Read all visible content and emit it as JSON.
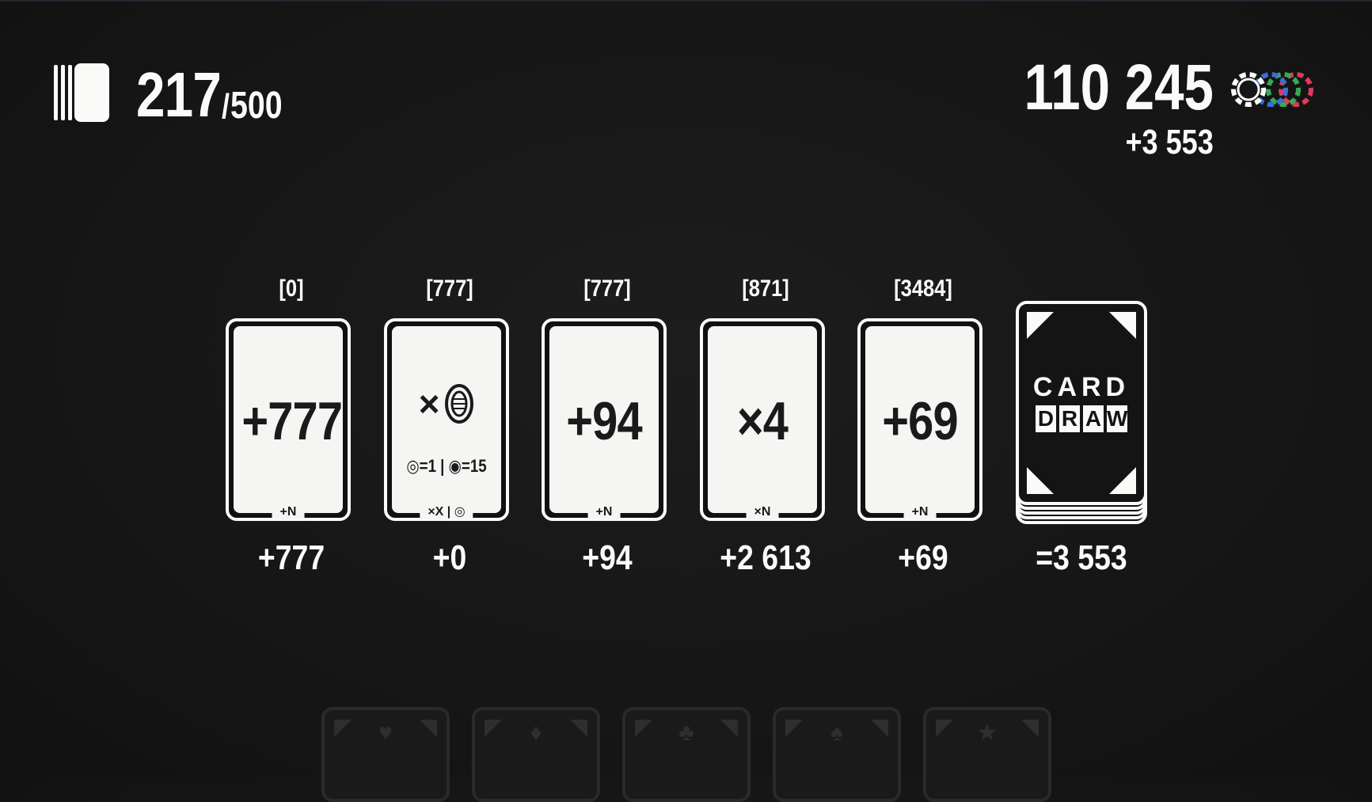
{
  "deck": {
    "count": "217",
    "separator": "/",
    "max": "500"
  },
  "score": {
    "total": "110 245",
    "delta": "+3 553"
  },
  "cards": [
    {
      "bracket": "[0]",
      "value": "+777",
      "tag": "+N",
      "result": "+777"
    },
    {
      "bracket": "[777]",
      "value": "×",
      "rates": "◎=1 | ◉=15",
      "tag": "×X | ◎",
      "result": "+0"
    },
    {
      "bracket": "[777]",
      "value": "+94",
      "tag": "+N",
      "result": "+94"
    },
    {
      "bracket": "[871]",
      "value": "×4",
      "tag": "×N",
      "result": "+2 613"
    },
    {
      "bracket": "[3484]",
      "value": "+69",
      "tag": "+N",
      "result": "+69"
    }
  ],
  "draw_pile": {
    "logo_top": "CARD",
    "logo_letters": [
      "D",
      "R",
      "A",
      "W"
    ],
    "total": "=3 553"
  },
  "hand": {
    "suits": [
      "♥",
      "♦",
      "♣",
      "♠",
      "★"
    ]
  },
  "colors": {
    "background": "#161616",
    "foreground": "#fafaf8",
    "chip_blue": "#3b6fd4",
    "chip_green": "#3aa856",
    "chip_red": "#e03a5a"
  },
  "icons": {
    "deck": "deck-icon",
    "chips": "chips-icon",
    "coin": "coin-icon"
  }
}
